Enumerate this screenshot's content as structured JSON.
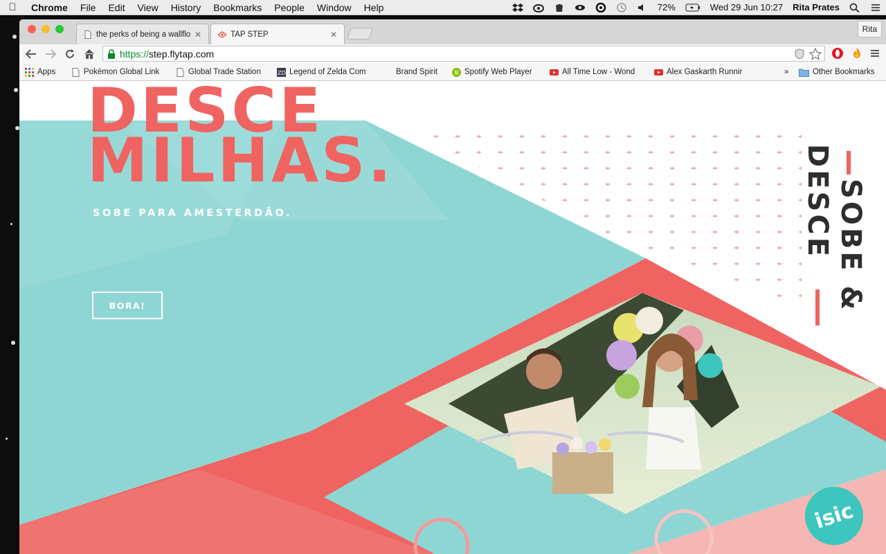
{
  "menubar": {
    "app": "Chrome",
    "items": [
      "File",
      "Edit",
      "View",
      "History",
      "Bookmarks",
      "People",
      "Window",
      "Help"
    ],
    "battery": "72%",
    "datetime": "Wed 29 Jun  10:27",
    "user": "Rita Prates"
  },
  "browser": {
    "tabs": [
      {
        "label": "the perks of being a wallflo"
      },
      {
        "label": "TAP STEP"
      }
    ],
    "profile": "Rita",
    "url_scheme": "https://",
    "url_host": "step.flytap.com",
    "bookmarks": [
      {
        "label": "Apps"
      },
      {
        "label": "Pokémon Global Link"
      },
      {
        "label": "Global Trade Station"
      },
      {
        "label": "Legend of Zelda Com"
      },
      {
        "label": "Brand Spirit"
      },
      {
        "label": "Spotify Web Player"
      },
      {
        "label": "All Time Low - Wond"
      },
      {
        "label": "Alex Gaskarth Runnir"
      },
      {
        "label": "»"
      },
      {
        "label": "Other Bookmarks"
      }
    ]
  },
  "page": {
    "title_line1": "DESCE",
    "title_line2": "MILHAS.",
    "subtitle": "SOBE PARA AMESTERDÃO.",
    "cta": "BORA!",
    "vertical_left": "DESCE",
    "vertical_right": "SOBE &",
    "badge": "isic"
  },
  "colors": {
    "coral": "#ef6461",
    "teal": "#8ed6d4",
    "dark_text": "#2e2e2e"
  }
}
